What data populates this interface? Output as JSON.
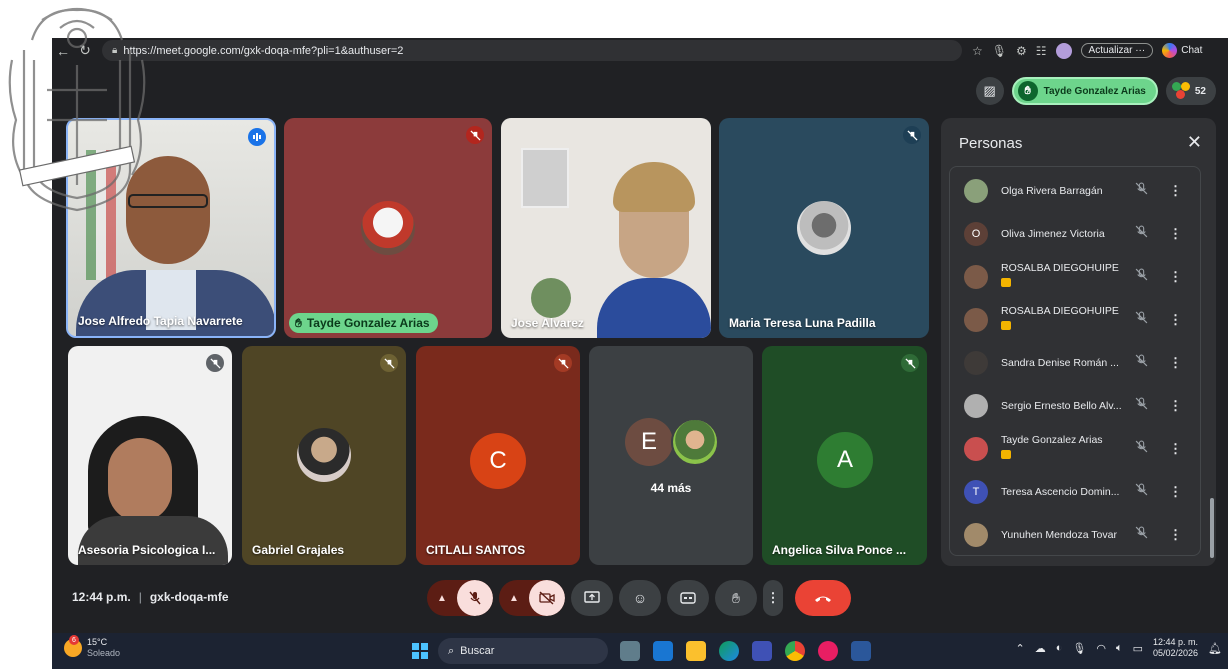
{
  "browser": {
    "url": "https://meet.google.com/gxk-doqa-mfe?pli=1&authuser=2",
    "update_label": "Actualizar",
    "chat_label": "Chat"
  },
  "top_right": {
    "hand_raised_name": "Tayde Gonzalez Arias",
    "participant_count": "52"
  },
  "tiles": [
    {
      "name": "Jose Alfredo Tapia Navarrete"
    },
    {
      "name": "Tayde Gonzalez Arias"
    },
    {
      "name": "Jose Alvarez"
    },
    {
      "name": "Maria Teresa Luna Padilla"
    },
    {
      "name": "Asesoria Psicologica I..."
    },
    {
      "name": "Gabriel Grajales"
    },
    {
      "name": "CITLALI SANTOS",
      "initial": "C",
      "color": "#d84315"
    },
    {
      "more_label": "44 más",
      "initial": "E",
      "color": "#6d4c41"
    },
    {
      "name": "Angelica Silva Ponce ...",
      "initial": "A",
      "color": "#2e7d32"
    }
  ],
  "people_panel": {
    "title": "Personas",
    "people": [
      {
        "name": "Olga Rivera Barragán",
        "badge": false,
        "avatar_color": "#8aa07a"
      },
      {
        "name": "Oliva Jimenez Victoria",
        "badge": false,
        "initial": "O",
        "avatar_color": "#5d4037"
      },
      {
        "name": "ROSALBA DIEGOHUIPE",
        "badge": true,
        "avatar_color": "#7b5a48"
      },
      {
        "name": "ROSALBA DIEGOHUIPE",
        "badge": true,
        "avatar_color": "#7b5a48"
      },
      {
        "name": "Sandra Denise Román ...",
        "badge": false,
        "avatar_color": "#3e3a38"
      },
      {
        "name": "Sergio Ernesto Bello Alv...",
        "badge": false,
        "avatar_color": "#b0b0b0"
      },
      {
        "name": "Tayde Gonzalez Arias",
        "badge": true,
        "avatar_color": "#c94f4f"
      },
      {
        "name": "Teresa Ascencio Domin...",
        "badge": false,
        "initial": "T",
        "avatar_color": "#3f51b5"
      },
      {
        "name": "Yunuhen Mendoza Tovar",
        "badge": false,
        "avatar_color": "#a18a6a"
      }
    ]
  },
  "meeting": {
    "time": "12:44 p.m.",
    "code": "gxk-doqa-mfe"
  },
  "taskbar": {
    "temperature": "15°C",
    "condition": "Soleado",
    "weather_badge": "6",
    "search_label": "Buscar",
    "clock_time": "12:44 p. m.",
    "clock_date": "05/02/2026"
  }
}
